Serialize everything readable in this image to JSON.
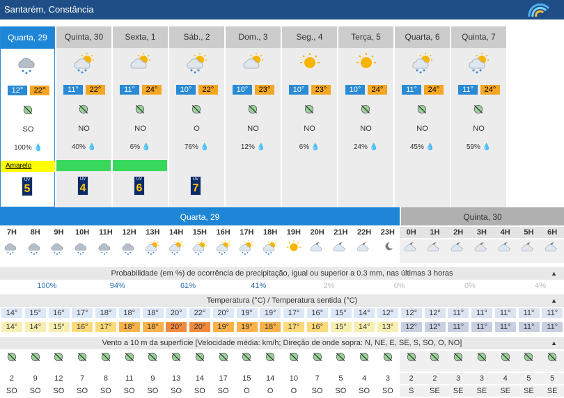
{
  "header": {
    "title": "Santarém, Constância",
    "logo_icon": "ipma-logo-icon"
  },
  "days": [
    {
      "label": "Quarta, 29",
      "icon": "rain-cloud-icon",
      "tmin": "12°",
      "tmax": "22°",
      "wind": "SO",
      "precip": "100%",
      "alert": "Amarelo",
      "alert_color": "#ffff00",
      "uv": "5",
      "uv_label": "UV",
      "selected": true
    },
    {
      "label": "Quinta, 30",
      "icon": "sun-rain-icon",
      "tmin": "11°",
      "tmax": "22°",
      "wind": "NO",
      "precip": "40%",
      "alert": "",
      "alert_color": "#38d85c",
      "uv": "4",
      "uv_label": "UV"
    },
    {
      "label": "Sexta, 1",
      "icon": "sun-cloud-icon",
      "tmin": "11°",
      "tmax": "24°",
      "wind": "NO",
      "precip": "6%",
      "alert": "",
      "alert_color": "#38d85c",
      "uv": "6",
      "uv_label": "UV"
    },
    {
      "label": "Sáb., 2",
      "icon": "sun-rain-icon",
      "tmin": "10°",
      "tmax": "22°",
      "wind": "O",
      "precip": "76%",
      "alert": "",
      "alert_color": "",
      "uv": "7",
      "uv_label": "UV"
    },
    {
      "label": "Dom., 3",
      "icon": "sun-cloud-icon",
      "tmin": "10°",
      "tmax": "23°",
      "wind": "NO",
      "precip": "12%",
      "alert": "",
      "alert_color": "",
      "uv": "",
      "uv_label": ""
    },
    {
      "label": "Seg., 4",
      "icon": "sun-icon",
      "tmin": "10°",
      "tmax": "23°",
      "wind": "NO",
      "precip": "6%",
      "alert": "",
      "alert_color": "",
      "uv": "",
      "uv_label": ""
    },
    {
      "label": "Terça, 5",
      "icon": "sun-icon",
      "tmin": "10°",
      "tmax": "24°",
      "wind": "NO",
      "precip": "24%",
      "alert": "",
      "alert_color": "",
      "uv": "",
      "uv_label": ""
    },
    {
      "label": "Quarta, 6",
      "icon": "sun-rain-icon",
      "tmin": "11°",
      "tmax": "24°",
      "wind": "NO",
      "precip": "45%",
      "alert": "",
      "alert_color": "",
      "uv": "",
      "uv_label": ""
    },
    {
      "label": "Quinta, 7",
      "icon": "sun-rain-icon",
      "tmin": "11°",
      "tmax": "24°",
      "wind": "NO",
      "precip": "59%",
      "alert": "",
      "alert_color": "",
      "uv": "",
      "uv_label": ""
    }
  ],
  "hourly": {
    "day1_label": "Quarta, 29",
    "day2_label": "Quinta, 30",
    "hours": [
      "7H",
      "8H",
      "9H",
      "10H",
      "11H",
      "12H",
      "13H",
      "14H",
      "15H",
      "16H",
      "17H",
      "18H",
      "19H",
      "20H",
      "21H",
      "22H",
      "23H",
      "0H",
      "1H",
      "2H",
      "3H",
      "4H",
      "5H",
      "6H"
    ],
    "icons": [
      "rain-cloud-icon",
      "rain-cloud-icon",
      "rain-cloud-icon",
      "rain-cloud-icon",
      "rain-cloud-icon",
      "rain-cloud-icon",
      "sun-rain-icon",
      "sun-rain-icon",
      "sun-rain-icon",
      "sun-rain-icon",
      "sun-rain-icon",
      "sun-rain-icon",
      "sun-icon",
      "moon-cloud-icon",
      "moon-cloud-icon",
      "moon-cloud-icon",
      "moon-icon",
      "moon-cloud-icon",
      "moon-cloud-icon",
      "moon-cloud-icon",
      "moon-cloud-icon",
      "moon-cloud-icon",
      "moon-cloud-icon",
      "moon-cloud-icon"
    ],
    "precip_title": "Probabilidade (em %) de ocorrência de precipitação, igual ou superior a 0.3 mm, nas últimas 3 horas",
    "precip": [
      {
        "v": "100%",
        "col": 2
      },
      {
        "v": "94%",
        "col": 5
      },
      {
        "v": "61%",
        "col": 8
      },
      {
        "v": "41%",
        "col": 11
      },
      {
        "v": "2%",
        "col": 14
      },
      {
        "v": "0%",
        "col": 17
      },
      {
        "v": "0%",
        "col": 20
      },
      {
        "v": "4%",
        "col": 23
      }
    ],
    "temp_title": "Temperatura (°C) / Temperatura sentida (°C)",
    "temp": [
      "14°",
      "15°",
      "16°",
      "17°",
      "18°",
      "18°",
      "18°",
      "20°",
      "22°",
      "20°",
      "19°",
      "19°",
      "17°",
      "16°",
      "15°",
      "14°",
      "12°",
      "12°",
      "12°",
      "11°",
      "11°",
      "11°",
      "11°",
      "11°"
    ],
    "feel": [
      "14°",
      "14°",
      "15°",
      "16°",
      "17°",
      "18°",
      "18°",
      "20°",
      "20°",
      "19°",
      "19°",
      "18°",
      "17°",
      "16°",
      "15°",
      "14°",
      "13°",
      "12°",
      "12°",
      "11°",
      "11°",
      "11°",
      "11°",
      "11°"
    ],
    "wind_title": "Vento a 10 m da superfície [Velocidade média: km/h; Direção de onde sopra: N, NE, E, SE, S, SO, O, NO]",
    "wind_speed": [
      "2",
      "9",
      "12",
      "7",
      "8",
      "11",
      "9",
      "13",
      "14",
      "17",
      "15",
      "14",
      "10",
      "7",
      "5",
      "4",
      "3",
      "2",
      "2",
      "3",
      "3",
      "4",
      "5",
      "5"
    ],
    "wind_dir": [
      "SO",
      "SO",
      "SO",
      "SO",
      "SO",
      "SO",
      "SO",
      "SO",
      "SO",
      "SO",
      "O",
      "O",
      "O",
      "SO",
      "SO",
      "SO",
      "SO",
      "S",
      "SE",
      "SE",
      "SE",
      "SE",
      "SE",
      "SE"
    ]
  },
  "colors": {
    "header_bg": "#1e4e85",
    "selected_tab": "#1e86d6",
    "tmin_bg": "#2a8ad4",
    "tmax_bg": "#f5a623"
  }
}
